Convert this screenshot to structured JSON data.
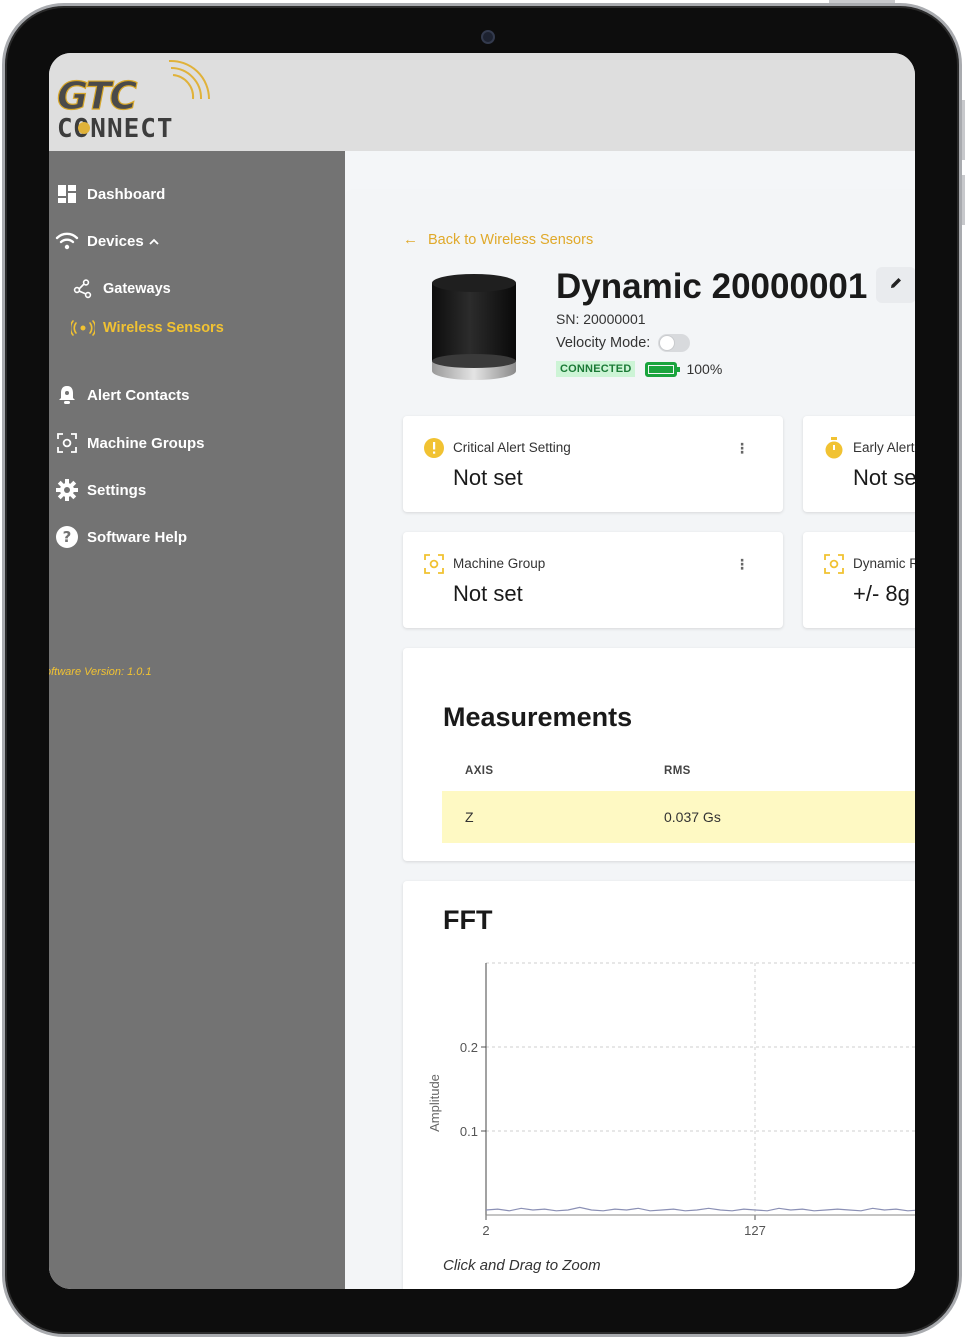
{
  "brand": {
    "logo_top": "GTC",
    "logo_bottom": "CONNECT",
    "colors": {
      "accent": "#f1c232",
      "sidebar": "#737373",
      "header": "#dedede"
    }
  },
  "sidebar": {
    "items": [
      {
        "label": "Dashboard",
        "icon": "dashboard-icon"
      },
      {
        "label": "Devices",
        "icon": "wifi-icon",
        "expanded": true
      },
      {
        "label": "Gateways",
        "icon": "gateway-icon"
      },
      {
        "label": "Wireless Sensors",
        "icon": "radio-icon",
        "active": true
      },
      {
        "label": "Alert Contacts",
        "icon": "bell-icon"
      },
      {
        "label": "Machine Groups",
        "icon": "machine-group-icon"
      },
      {
        "label": "Settings",
        "icon": "gear-icon"
      },
      {
        "label": "Software Help",
        "icon": "help-icon"
      }
    ],
    "version": "oftware Version: 1.0.1"
  },
  "main": {
    "back_label": "Back to Wireless Sensors",
    "sensor": {
      "title": "Dynamic 20000001",
      "sn": "SN: 20000001",
      "velocity_label": "Velocity Mode:",
      "velocity_on": false,
      "status": "CONNECTED",
      "battery": "100%",
      "battery_level": 1.0
    },
    "cards": [
      {
        "label": "Critical Alert Setting",
        "value": "Not set",
        "icon": "alert-circle-icon"
      },
      {
        "label": "Early Alert",
        "value": "Not se",
        "icon": "timer-icon"
      },
      {
        "label": "Machine Group",
        "value": "Not set",
        "icon": "machine-group-icon"
      },
      {
        "label": "Dynamic R",
        "value": "+/- 8g",
        "icon": "machine-group-icon"
      }
    ],
    "measurements": {
      "title": "Measurements",
      "columns": [
        "AXIS",
        "RMS"
      ],
      "rows": [
        {
          "axis": "Z",
          "rms": "0.037 Gs"
        }
      ]
    },
    "fft": {
      "title": "FFT",
      "hint": "Click and Drag to Zoom"
    }
  },
  "chart_data": {
    "type": "line",
    "title": "FFT",
    "xlabel": "",
    "ylabel": "Amplitude",
    "x_ticks": [
      "2",
      "127"
    ],
    "y_ticks": [
      "0.1",
      "0.2"
    ],
    "ylim": [
      0,
      0.3
    ],
    "grid": true,
    "series": [
      {
        "values": [
          0.006,
          0.007,
          0.005,
          0.008,
          0.006,
          0.007,
          0.005,
          0.006,
          0.009,
          0.006,
          0.005,
          0.007,
          0.006,
          0.008,
          0.005,
          0.006,
          0.007,
          0.005,
          0.006,
          0.008,
          0.006,
          0.005,
          0.007,
          0.006,
          0.005,
          0.008,
          0.006,
          0.007,
          0.005,
          0.006,
          0.007,
          0.006,
          0.005,
          0.008,
          0.006,
          0.007,
          0.005,
          0.006,
          0.007,
          0.005
        ]
      }
    ]
  }
}
